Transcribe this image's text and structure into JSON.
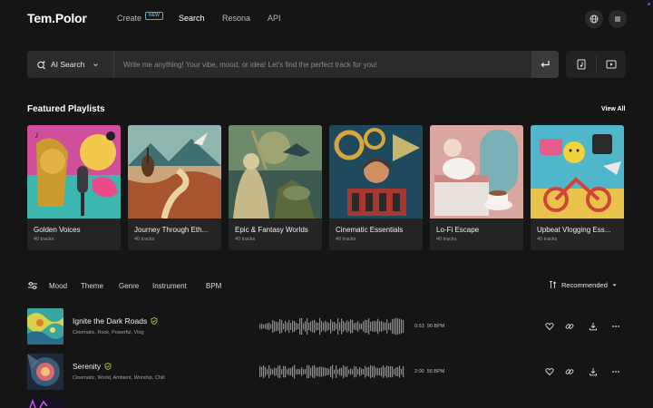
{
  "nav": {
    "logo": "Tem.Polor",
    "items": [
      {
        "label": "Create",
        "active": false,
        "badge": "NEW"
      },
      {
        "label": "Search",
        "active": true
      },
      {
        "label": "Resona",
        "active": false
      },
      {
        "label": "API",
        "active": false
      }
    ],
    "right_icons": [
      "globe-icon",
      "menu-icon"
    ]
  },
  "search": {
    "mode_label": "AI Search",
    "placeholder": "Write me anything! Your vibe, mood, or idea! Let's find the perfect track for you!",
    "value": ""
  },
  "featured": {
    "title": "Featured Playlists",
    "view_all": "View All",
    "playlists": [
      {
        "title": "Golden Voices",
        "count": "40 tracks"
      },
      {
        "title": "Journey Through Eth...",
        "count": "40 tracks"
      },
      {
        "title": "Epic & Fantasy Worlds",
        "count": "40 tracks"
      },
      {
        "title": "Cinematic Essentials",
        "count": "40 tracks"
      },
      {
        "title": "Lo-Fi Escape",
        "count": "40 tracks"
      },
      {
        "title": "Upbeat Vlogging Ess...",
        "count": "40 tracks"
      }
    ]
  },
  "filters": {
    "items": [
      "Mood",
      "Theme",
      "Genre",
      "Instrument",
      "BPM"
    ],
    "sort_label": "Recommended"
  },
  "tracks": [
    {
      "title": "Ignite the Dark Roads",
      "tags": "Cinematic, Rock, Powerful, Vlog",
      "duration": "0:53",
      "bpm": "90 BPM"
    },
    {
      "title": "Serenity",
      "tags": "Cinematic, World, Ambient, Worship, Chill",
      "duration": "2:00",
      "bpm": "56 BPM"
    }
  ],
  "colors": {
    "background": "#151515",
    "surface": "#242424",
    "accent_new_badge": "#4fb3c9",
    "verified": "#c9d84a"
  }
}
